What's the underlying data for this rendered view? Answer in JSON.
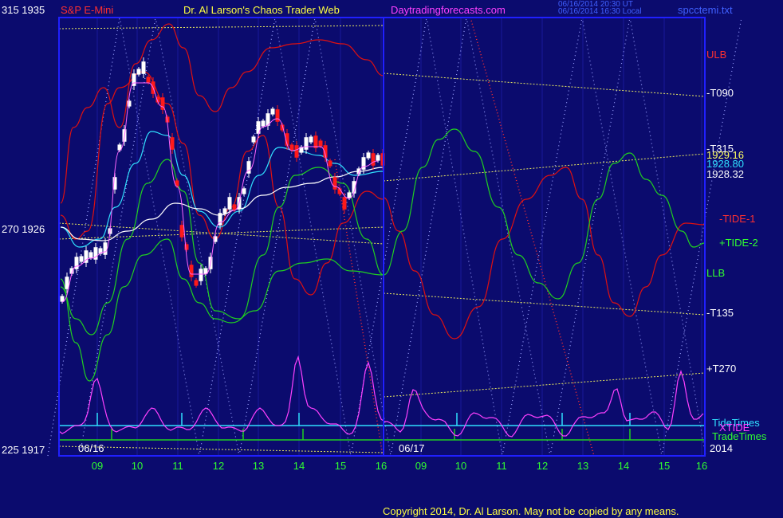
{
  "colors": {
    "background": "#0b0b6e",
    "frame": "#2020ff",
    "price_up": "#ffffff",
    "price_down": "#ff1a1a",
    "red_band": "#e01010",
    "green_band": "#20d020",
    "tide_red": "#e01010",
    "tide_green": "#20d020",
    "ma_cyan": "#30e0ff",
    "ma_white": "#ffffff",
    "ma_pink": "#ff66ff",
    "timing_magenta": "#ff40ff",
    "trend_yellow": "#e8e860",
    "tide_times": "#30e0ff",
    "trade_times": "#20d020"
  },
  "header": {
    "left_scale": "315  1935",
    "symbol": "S&P E-Mini",
    "site_title": "Dr. Al Larson's Chaos Trader Web",
    "site_url": "Daytradingforecasts.com",
    "timestamp1": "06/16/2014 20:30 UT",
    "timestamp2": "06/16/2014 16:30 Local",
    "file": "spcctemi.txt"
  },
  "left_axis": {
    "mid": "270  1926",
    "bottom": "225  1917"
  },
  "right_labels": {
    "ulb": "ULB",
    "t090": "-T090",
    "t315": "-T315",
    "p1": "1929.16",
    "p2": "1928.80",
    "p3": "1928.32",
    "tide1": "-TIDE-1",
    "tide2": "+TIDE-2",
    "llb": "LLB",
    "t135": "-T135",
    "t270": "+T270",
    "tide_times": "TideTimes",
    "xtide": "XTIDE",
    "trade_times": "TradeTimes",
    "year": "2014"
  },
  "date_labels": [
    "06/16",
    "06/17"
  ],
  "copyright": "Copyright 2014, Dr. Al Larson. May not be copied by any means.",
  "chart_data": {
    "type": "line",
    "price_axis": [
      1917,
      1935
    ],
    "angle_axis": [
      225,
      315
    ],
    "x_hour_ticks": [
      "09",
      "10",
      "11",
      "12",
      "13",
      "14",
      "15",
      "16",
      "09",
      "10",
      "11",
      "12",
      "13",
      "14",
      "15",
      "16"
    ],
    "last_prices": [
      1929.16,
      1928.8,
      1928.32
    ]
  }
}
